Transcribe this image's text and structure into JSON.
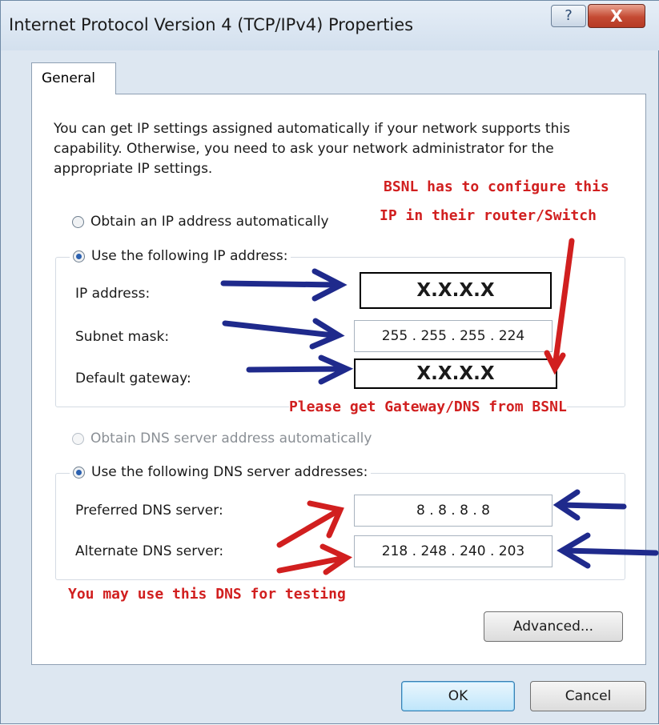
{
  "window": {
    "title": "Internet Protocol Version 4 (TCP/IPv4) Properties",
    "help_label": "?",
    "close_label": "X"
  },
  "tabs": [
    {
      "label": "General"
    }
  ],
  "description": "You can get IP settings assigned automatically if your network supports this capability. Otherwise, you need to ask your network administrator for the appropriate IP settings.",
  "ip_section": {
    "auto_label": "Obtain an IP address automatically",
    "manual_label": "Use the following IP address:",
    "ip_address_label": "IP address:",
    "ip_address_value": "X.X.X.X",
    "subnet_label": "Subnet mask:",
    "subnet_value": "255 . 255 . 255 . 224",
    "gateway_label": "Default gateway:",
    "gateway_value": "X.X.X.X"
  },
  "dns_section": {
    "auto_label": "Obtain DNS server address automatically",
    "manual_label": "Use the following DNS server addresses:",
    "preferred_label": "Preferred DNS server:",
    "preferred_value": "8 . 8 . 8 . 8",
    "alternate_label": "Alternate DNS server:",
    "alternate_value": "218 . 248 . 240 . 203"
  },
  "buttons": {
    "advanced": "Advanced...",
    "ok": "OK",
    "cancel": "Cancel"
  },
  "annotations": {
    "bsnl_line1": "BSNL has to configure this",
    "bsnl_line2": "IP in their router/Switch",
    "gateway_note": "Please get Gateway/DNS from BSNL",
    "dns_note": "You may use this DNS for testing"
  },
  "colors": {
    "annotation_red": "#d11f1f",
    "annotation_blue": "#1f2a8c"
  }
}
